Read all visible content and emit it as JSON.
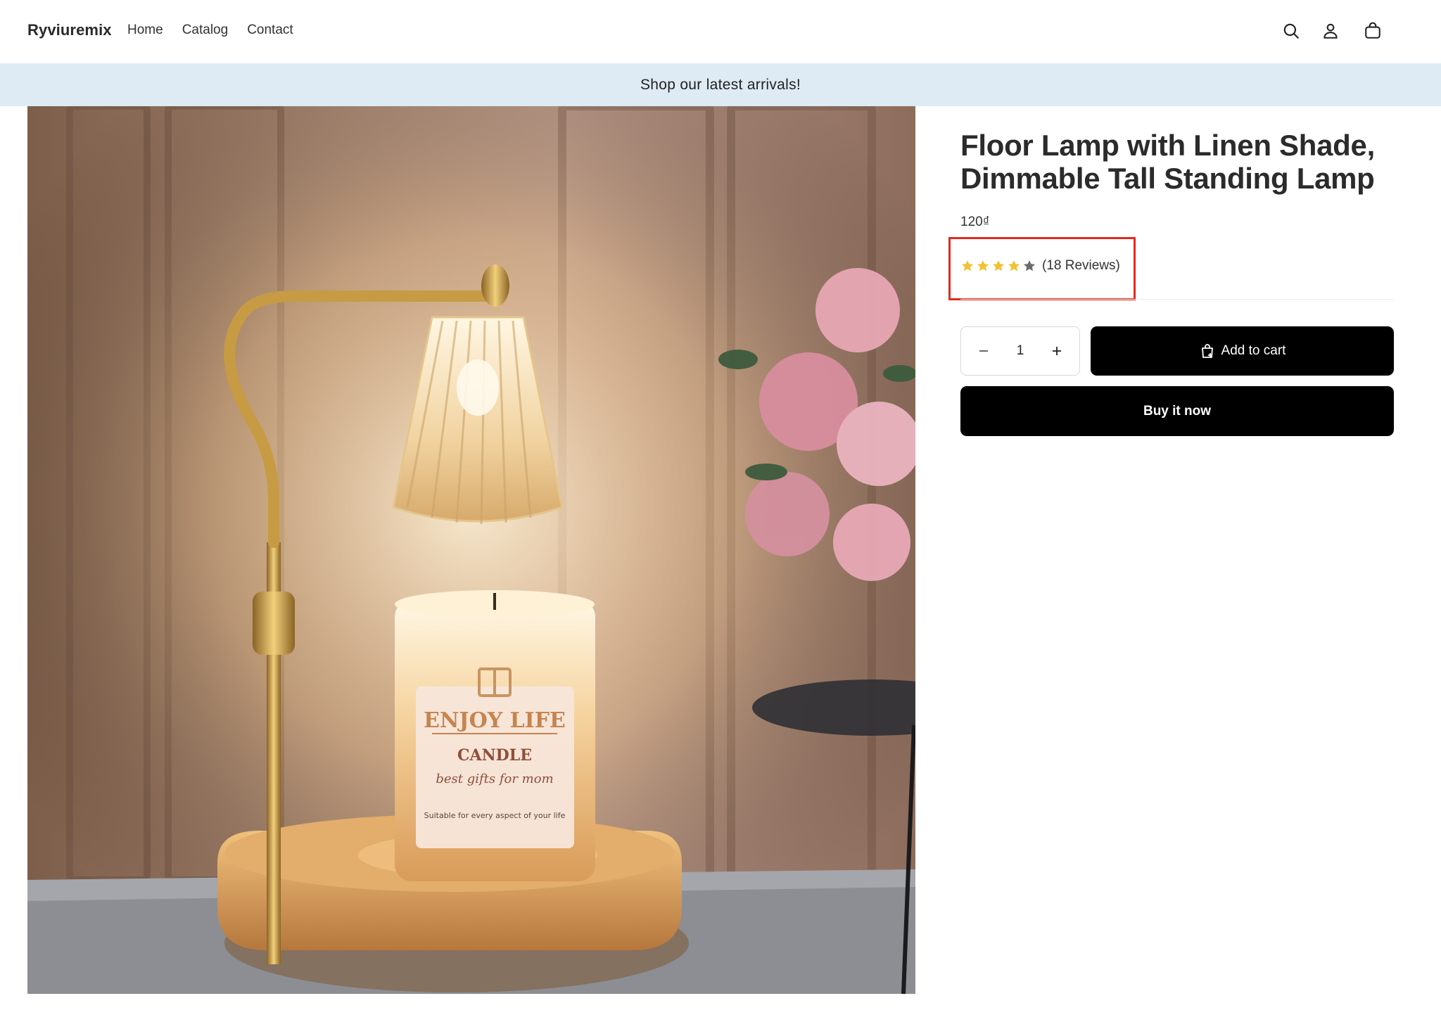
{
  "header": {
    "brand": "Ryviuremix",
    "nav": [
      "Home",
      "Catalog",
      "Contact"
    ],
    "icons": [
      "search-icon",
      "account-icon",
      "cart-icon"
    ]
  },
  "announcement": "Shop our latest arrivals!",
  "product": {
    "title": "Floor Lamp with Linen Shade, Dimmable Tall Standing Lamp",
    "price": "120₫",
    "rating": {
      "value": 4,
      "max": 5,
      "reviews_label": "(18 Reviews)"
    },
    "quantity": "1",
    "add_to_cart_label": "Add to cart",
    "buy_now_label": "Buy it now",
    "image": {
      "candle_label": "ENJOY LIFE",
      "candle_sub": "CANDLE",
      "candle_script": "best gifts for mom",
      "candle_small": "Suitable for every aspect of your life"
    }
  },
  "colors": {
    "announcement_bg": "#deeaf4",
    "button_bg": "#000000",
    "star_filled": "#f2c230",
    "star_empty": "#6b6b6b",
    "highlight": "#e02b1e"
  }
}
